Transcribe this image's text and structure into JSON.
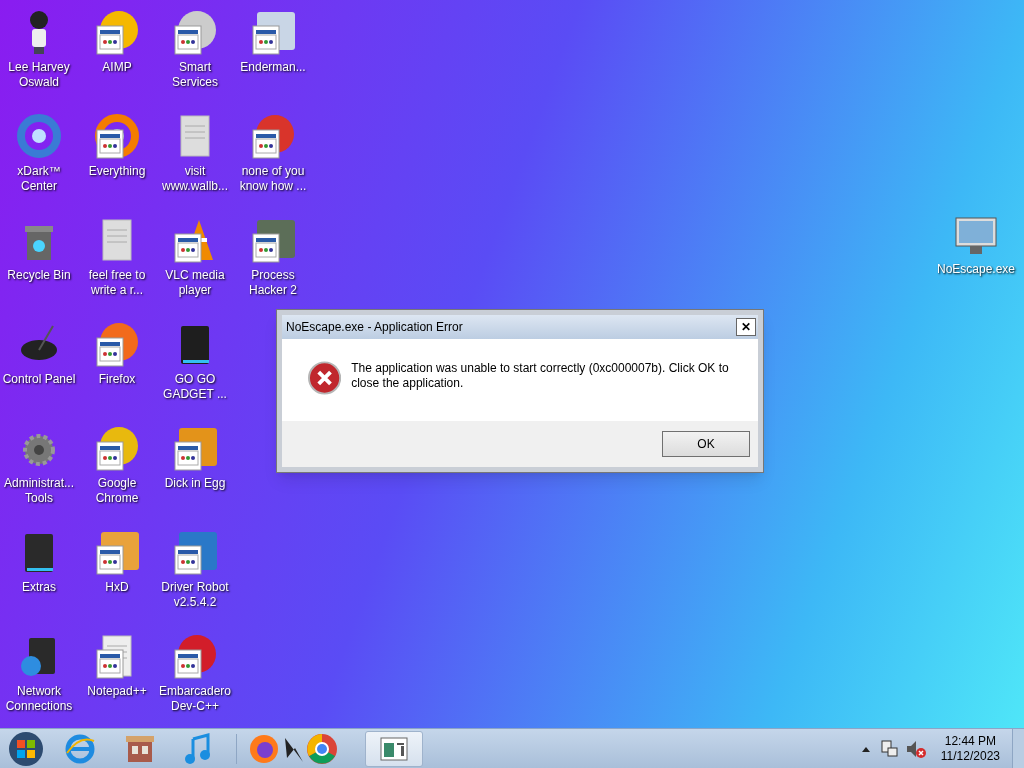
{
  "desktop": {
    "icons": [
      {
        "label": "Lee Harvey Oswald"
      },
      {
        "label": "xDark™ Center"
      },
      {
        "label": "Recycle Bin"
      },
      {
        "label": "Control Panel"
      },
      {
        "label": "Administrat... Tools"
      },
      {
        "label": "Extras"
      },
      {
        "label": "Network Connections"
      },
      {
        "label": "AIMP"
      },
      {
        "label": "Everything"
      },
      {
        "label": "feel free to write a r..."
      },
      {
        "label": "Firefox"
      },
      {
        "label": "Google Chrome"
      },
      {
        "label": "HxD"
      },
      {
        "label": "Notepad++"
      },
      {
        "label": "Smart Services"
      },
      {
        "label": "visit www.wallb..."
      },
      {
        "label": "VLC media player"
      },
      {
        "label": "GO GO GADGET ..."
      },
      {
        "label": "Dick in Egg"
      },
      {
        "label": "Driver Robot v2.5.4.2"
      },
      {
        "label": "Embarcadero Dev-C++"
      },
      {
        "label": "Enderman..."
      },
      {
        "label": "none of you know how ..."
      },
      {
        "label": "Process Hacker 2"
      }
    ],
    "extra_icon": {
      "label": "NoEscape.exe"
    }
  },
  "dialog": {
    "title": "NoEscape.exe - Application Error",
    "close": "✕",
    "message": "The application was unable to start correctly (0xc000007b). Click OK to close the application.",
    "button": "OK"
  },
  "taskbar": {
    "clock": {
      "time": "12:44 PM",
      "date": "11/12/2023"
    }
  }
}
